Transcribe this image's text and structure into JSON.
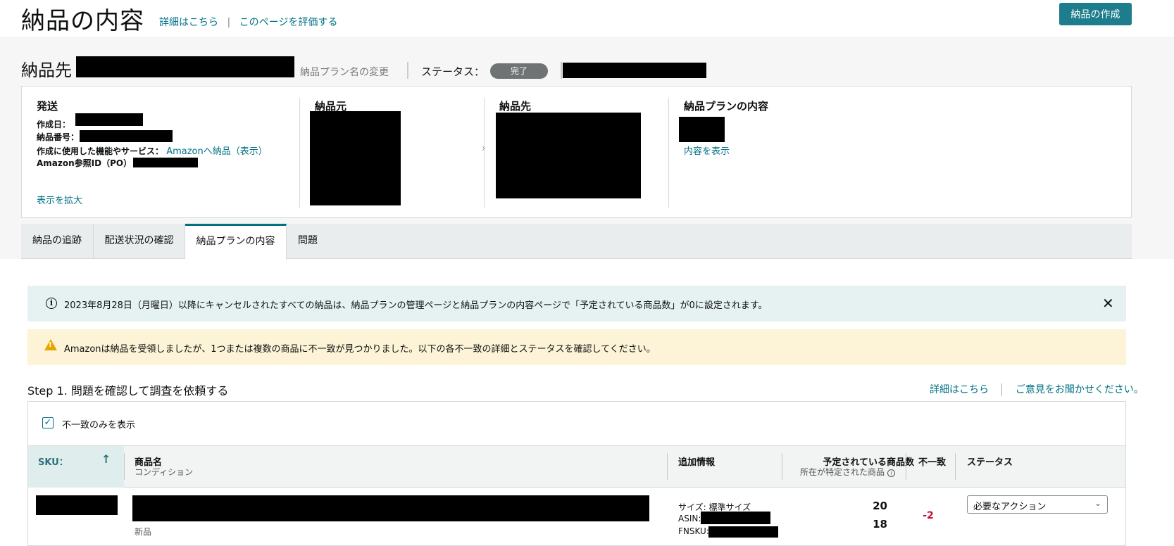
{
  "header": {
    "title": "納品の内容",
    "link_details": "詳細はこちら",
    "link_separator": "|",
    "link_rate": "このページを評価する",
    "create_button": "納品の作成"
  },
  "destination": {
    "label": "納品先",
    "rename_link": "納品プラン名の変更",
    "status_label": "ステータス：",
    "status_value": "完了"
  },
  "summary": {
    "shipping": {
      "heading": "発送",
      "created_label": "作成日：",
      "shipment_no_label": "納品番号：",
      "feature_label": "作成に使用した機能やサービス：",
      "feature_link": "Amazonへ納品（表示）",
      "po_label": "Amazon参照ID（PO）",
      "expand_link": "表示を拡大"
    },
    "ship_from": {
      "heading": "納品元"
    },
    "ship_to": {
      "heading": "納品先"
    },
    "plan": {
      "heading": "納品プランの内容",
      "view_link": "内容を表示"
    }
  },
  "tabs": [
    {
      "label": "納品の追跡"
    },
    {
      "label": "配送状況の確認"
    },
    {
      "label": "納品プランの内容"
    },
    {
      "label": "問題"
    }
  ],
  "alerts": {
    "info": "2023年8月28日（月曜日）以降にキャンセルされたすべての納品は、納品プランの管理ページと納品プランの内容ページで「予定されている商品数」が0に設定されます。",
    "warning": "Amazonは納品を受領しましたが、1つまたは複数の商品に不一致が見つかりました。以下の各不一致の詳細とステータスを確認してください。"
  },
  "step": {
    "title": "Step 1. 問題を確認して調査を依頼する",
    "link_details": "詳細はこちら",
    "link_feedback": "ご意見をお聞かせください。",
    "filter_label": "不一致のみを表示"
  },
  "table": {
    "headers": {
      "sku": "SKU：",
      "product": "商品名",
      "product_sub": "コンディション",
      "extra": "追加情報",
      "expected": "予定されている商品数",
      "expected_sub": "所在が特定された商品",
      "mismatch": "不一致",
      "status": "ステータス"
    },
    "rows": [
      {
        "condition": "新品",
        "size": "サイズ: 標準サイズ",
        "asin_label": "ASIN:",
        "fnsku_label": "FNSKU:",
        "expected": "20",
        "located": "18",
        "mismatch": "-2",
        "status": "必要なアクション"
      }
    ]
  },
  "colors": {
    "accent": "#007185",
    "button": "#1e7d8c",
    "warning": "#e8a500",
    "negative": "#cc0c39"
  }
}
